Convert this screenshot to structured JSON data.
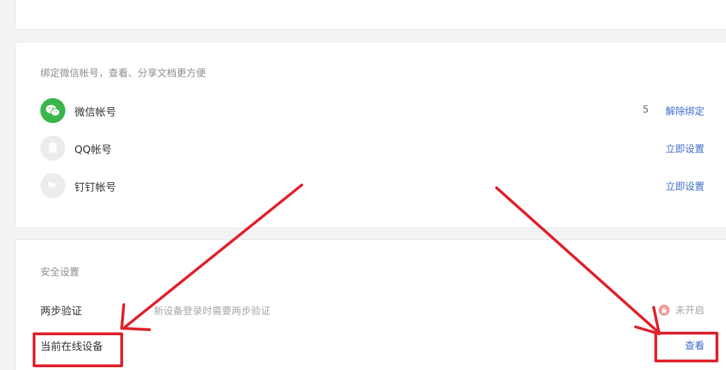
{
  "bind_section": {
    "title": "绑定微信帐号，查看、分享文档更方便",
    "accounts": [
      {
        "icon": "wechat-icon",
        "name": "微信帐号",
        "count": "5",
        "action": "解除绑定"
      },
      {
        "icon": "qq-icon",
        "name": "QQ帐号",
        "count": "",
        "action": "立即设置"
      },
      {
        "icon": "dingtalk-icon",
        "name": "钉钉帐号",
        "count": "",
        "action": "立即设置"
      }
    ]
  },
  "security_section": {
    "title": "安全设置",
    "two_step": {
      "label": "两步验证",
      "description": "新设备登录时需要两步验证",
      "status": "未开启",
      "status_icon": "lock-icon"
    },
    "online_devices": {
      "label": "当前在线设备",
      "action": "查看"
    }
  },
  "colors": {
    "link": "#3f6ccc",
    "wechat_green": "#3bb54a",
    "annotation_red": "#e0202a"
  }
}
